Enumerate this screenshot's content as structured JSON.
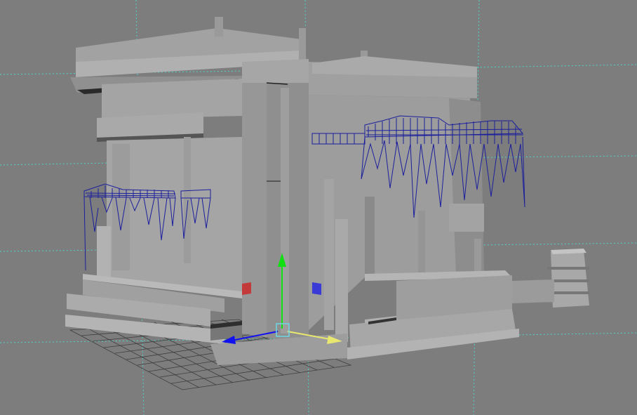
{
  "viewport": {
    "background_color": "#7d7d7d",
    "grid_line_color": "#4fd3c8",
    "floor_grid_color": "#3e3e3e",
    "geometry_light": "#a8a8a8",
    "geometry_mid": "#959595",
    "geometry_dark": "#6a6a6a",
    "selection_wireframe_color": "#1b1f9c"
  },
  "manipulator": {
    "type": "move-tool",
    "x_axis_color": "#1010f0",
    "y_axis_color": "#10e010",
    "z_axis_color": "#e8e870",
    "center_handle_color": "#6fd6e6",
    "plane_handle_red": "#c23a3a",
    "plane_handle_blue": "#3a3ad6"
  },
  "objects": [
    {
      "name": "temple-building-main"
    },
    {
      "name": "vine-wireframe-left"
    },
    {
      "name": "vine-wireframe-right"
    },
    {
      "name": "floor-grid"
    }
  ]
}
